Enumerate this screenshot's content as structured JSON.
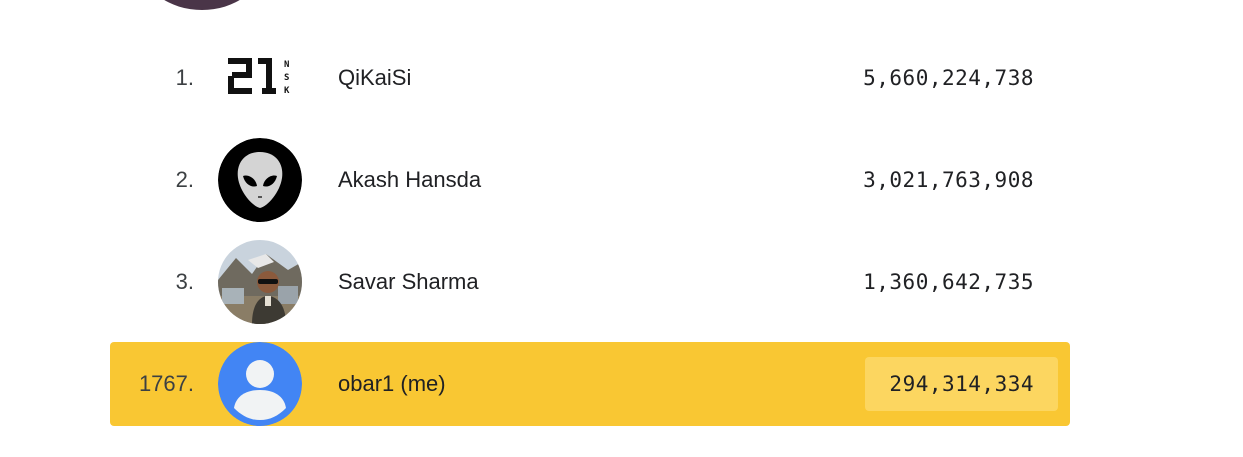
{
  "leaderboard": {
    "rows": [
      {
        "rank": "1.",
        "name": "QiKaiSi",
        "score": "5,660,224,738",
        "avatar": "logo-21nsk-icon"
      },
      {
        "rank": "2.",
        "name": "Akash Hansda",
        "score": "3,021,763,908",
        "avatar": "alien-icon"
      },
      {
        "rank": "3.",
        "name": "Savar Sharma",
        "score": "1,360,642,735",
        "avatar": "photo-avatar"
      },
      {
        "rank": "1767.",
        "name": "obar1 (me)",
        "score": "294,314,334",
        "avatar": "default-user-icon",
        "highlight": true
      }
    ]
  },
  "colors": {
    "highlight_row": "#f9c733",
    "highlight_score": "#fcd660",
    "default_avatar": "#4285f4"
  }
}
